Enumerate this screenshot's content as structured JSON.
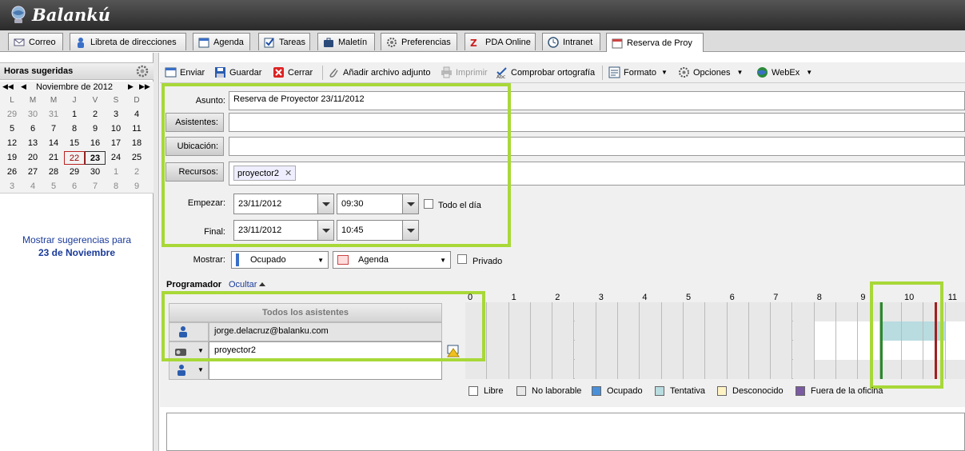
{
  "app": {
    "name": "Balankú"
  },
  "tabs": [
    {
      "label": "Correo",
      "icon": "mail-icon"
    },
    {
      "label": "Libreta de direcciones",
      "icon": "contacts-icon"
    },
    {
      "label": "Agenda",
      "icon": "calendar-icon"
    },
    {
      "label": "Tareas",
      "icon": "tasks-icon"
    },
    {
      "label": "Maletín",
      "icon": "briefcase-icon"
    },
    {
      "label": "Preferencias",
      "icon": "gear-icon"
    },
    {
      "label": "PDA Online",
      "icon": "pda-icon"
    },
    {
      "label": "Intranet",
      "icon": "clock-icon"
    },
    {
      "label": "Reserva de Proy",
      "icon": "appointment-icon",
      "active": true
    }
  ],
  "sidebar": {
    "title": "Horas sugeridas",
    "calendar": {
      "month": "Noviembre de 2012",
      "weekdays": [
        "L",
        "M",
        "M",
        "J",
        "V",
        "S",
        "D"
      ],
      "weeks": [
        [
          "29",
          "30",
          "31",
          "1",
          "2",
          "3",
          "4"
        ],
        [
          "5",
          "6",
          "7",
          "8",
          "9",
          "10",
          "11"
        ],
        [
          "12",
          "13",
          "14",
          "15",
          "16",
          "17",
          "18"
        ],
        [
          "19",
          "20",
          "21",
          "22",
          "23",
          "24",
          "25"
        ],
        [
          "26",
          "27",
          "28",
          "29",
          "30",
          "1",
          "2"
        ],
        [
          "3",
          "4",
          "5",
          "6",
          "7",
          "8",
          "9"
        ]
      ],
      "today": "22",
      "selected": "23"
    },
    "suggest_line1": "Mostrar sugerencias para",
    "suggest_line2": "23 de Noviembre"
  },
  "toolbar": {
    "send": "Enviar",
    "save": "Guardar",
    "close": "Cerrar",
    "attach": "Añadir archivo adjunto",
    "print": "Imprimir",
    "spell": "Comprobar ortografía",
    "format": "Formato",
    "options": "Opciones",
    "webex": "WebEx"
  },
  "form": {
    "subject_label": "Asunto:",
    "subject_value": "Reserva de Proyector 23/11/2012",
    "attendees_label": "Asistentes:",
    "location_label": "Ubicación:",
    "resources_label": "Recursos:",
    "resource_chip": "proyector2",
    "start_label": "Empezar:",
    "start_date": "23/11/2012",
    "start_time": "09:30",
    "allday_label": "Todo el día",
    "end_label": "Final:",
    "end_date": "23/11/2012",
    "end_time": "10:45",
    "show_label": "Mostrar:",
    "show_value": "Ocupado",
    "calendar_value": "Agenda",
    "private_label": "Privado"
  },
  "scheduler": {
    "title": "Programador",
    "toggle": "Ocultar",
    "all_attendees": "Todos los asistentes",
    "attendee1": "jorge.delacruz@balanku.com",
    "resource1": "proyector2",
    "hours": [
      "0",
      "1",
      "2",
      "3",
      "4",
      "5",
      "6",
      "7",
      "8",
      "9",
      "10",
      "11"
    ],
    "legend": [
      {
        "label": "Libre",
        "color": "#ffffff"
      },
      {
        "label": "No laborable",
        "color": "#e8e8e8"
      },
      {
        "label": "Ocupado",
        "color": "#4a90d9"
      },
      {
        "label": "Tentativa",
        "color": "#b8dce0"
      },
      {
        "label": "Desconocido",
        "color": "#fff3c4"
      },
      {
        "label": "Fuera de la oficina",
        "color": "#7a5aa0"
      }
    ]
  }
}
